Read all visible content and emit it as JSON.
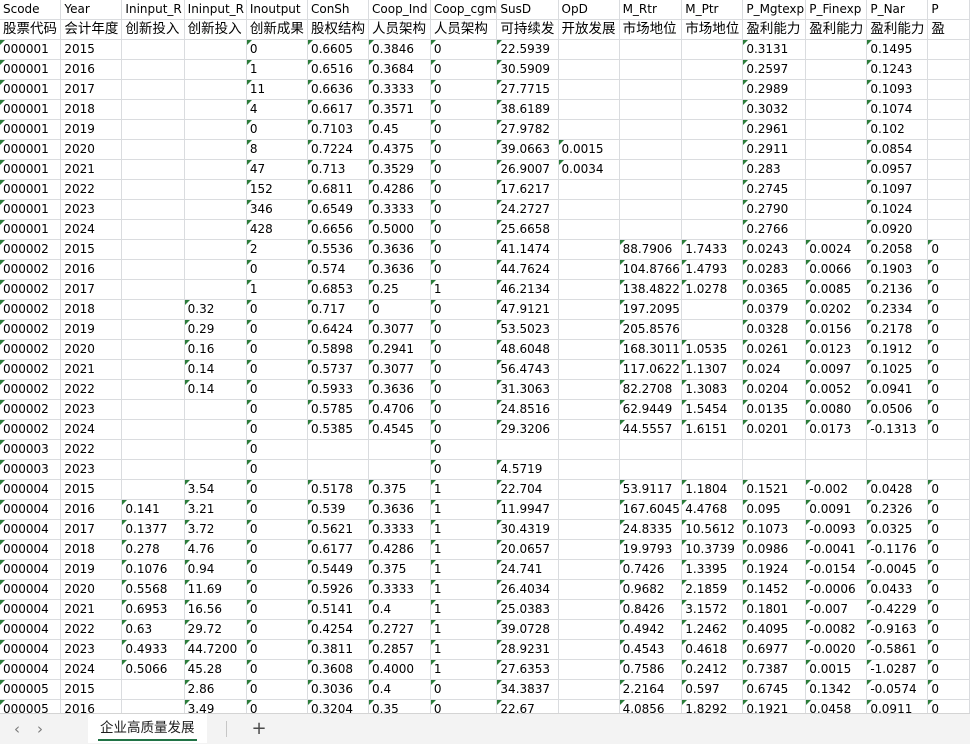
{
  "headers": [
    "Scode",
    "Year",
    "Ininput_R",
    "Ininput_R",
    "Inoutput",
    "ConSh",
    "Coop_Ind",
    "Coop_cgm",
    "SusD",
    "OpD",
    "M_Rtr",
    "M_Ptr",
    "P_Mgtexp",
    "P_Finexp",
    "P_Nar",
    "P"
  ],
  "labels": [
    "股票代码",
    "会计年度",
    "创新投入",
    "创新投入",
    "创新成果",
    "股权结构",
    "人员架构",
    "人员架构",
    "可持续发",
    "开放发展",
    "市场地位",
    "市场地位",
    "盈利能力",
    "盈利能力",
    "盈利能力",
    "盈"
  ],
  "rows": [
    [
      "000001",
      "2015",
      "",
      "",
      "0",
      "0.6605",
      "0.3846",
      "0",
      "22.5939",
      "",
      "",
      "",
      "0.3131",
      "",
      "0.1495",
      ""
    ],
    [
      "000001",
      "2016",
      "",
      "",
      "1",
      "0.6516",
      "0.3684",
      "0",
      "30.5909",
      "",
      "",
      "",
      "0.2597",
      "",
      "0.1243",
      ""
    ],
    [
      "000001",
      "2017",
      "",
      "",
      "11",
      "0.6636",
      "0.3333",
      "0",
      "27.7715",
      "",
      "",
      "",
      "0.2989",
      "",
      "0.1093",
      ""
    ],
    [
      "000001",
      "2018",
      "",
      "",
      "4",
      "0.6617",
      "0.3571",
      "0",
      "38.6189",
      "",
      "",
      "",
      "0.3032",
      "",
      "0.1074",
      ""
    ],
    [
      "000001",
      "2019",
      "",
      "",
      "0",
      "0.7103",
      "0.45",
      "0",
      "27.9782",
      "",
      "",
      "",
      "0.2961",
      "",
      "0.102",
      ""
    ],
    [
      "000001",
      "2020",
      "",
      "",
      "8",
      "0.7224",
      "0.4375",
      "0",
      "39.0663",
      "0.0015",
      "",
      "",
      "0.2911",
      "",
      "0.0854",
      ""
    ],
    [
      "000001",
      "2021",
      "",
      "",
      "47",
      "0.713",
      "0.3529",
      "0",
      "26.9007",
      "0.0034",
      "",
      "",
      "0.283",
      "",
      "0.0957",
      ""
    ],
    [
      "000001",
      "2022",
      "",
      "",
      "152",
      "0.6811",
      "0.4286",
      "0",
      "17.6217",
      "",
      "",
      "",
      "0.2745",
      "",
      "0.1097",
      ""
    ],
    [
      "000001",
      "2023",
      "",
      "",
      "346",
      "0.6549",
      "0.3333",
      "0",
      "24.2727",
      "",
      "",
      "",
      "0.2790",
      "",
      "0.1024",
      ""
    ],
    [
      "000001",
      "2024",
      "",
      "",
      "428",
      "0.6656",
      "0.5000",
      "0",
      "25.6658",
      "",
      "",
      "",
      "0.2766",
      "",
      "0.0920",
      ""
    ],
    [
      "000002",
      "2015",
      "",
      "",
      "2",
      "0.5536",
      "0.3636",
      "0",
      "41.1474",
      "",
      "88.7906",
      "1.7433",
      "0.0243",
      "0.0024",
      "0.2058",
      "0"
    ],
    [
      "000002",
      "2016",
      "",
      "",
      "0",
      "0.574",
      "0.3636",
      "0",
      "44.7624",
      "",
      "104.8766",
      "1.4793",
      "0.0283",
      "0.0066",
      "0.1903",
      "0"
    ],
    [
      "000002",
      "2017",
      "",
      "",
      "1",
      "0.6853",
      "0.25",
      "1",
      "46.2134",
      "",
      "138.4822",
      "1.0278",
      "0.0365",
      "0.0085",
      "0.2136",
      "0"
    ],
    [
      "000002",
      "2018",
      "",
      "0.32",
      "0",
      "0.717",
      "0",
      "0",
      "47.9121",
      "",
      "197.2095",
      "",
      "0.0379",
      "0.0202",
      "0.2334",
      "0"
    ],
    [
      "000002",
      "2019",
      "",
      "0.29",
      "0",
      "0.6424",
      "0.3077",
      "0",
      "53.5023",
      "",
      "205.8576",
      "",
      "0.0328",
      "0.0156",
      "0.2178",
      "0"
    ],
    [
      "000002",
      "2020",
      "",
      "0.16",
      "0",
      "0.5898",
      "0.2941",
      "0",
      "48.6048",
      "",
      "168.3011",
      "1.0535",
      "0.0261",
      "0.0123",
      "0.1912",
      "0"
    ],
    [
      "000002",
      "2021",
      "",
      "0.14",
      "0",
      "0.5737",
      "0.3077",
      "0",
      "56.4743",
      "",
      "117.0622",
      "1.1307",
      "0.024",
      "0.0097",
      "0.1025",
      "0"
    ],
    [
      "000002",
      "2022",
      "",
      "0.14",
      "0",
      "0.5933",
      "0.3636",
      "0",
      "31.3063",
      "",
      "82.2708",
      "1.3083",
      "0.0204",
      "0.0052",
      "0.0941",
      "0"
    ],
    [
      "000002",
      "2023",
      "",
      "",
      "0",
      "0.5785",
      "0.4706",
      "0",
      "24.8516",
      "",
      "62.9449",
      "1.5454",
      "0.0135",
      "0.0080",
      "0.0506",
      "0"
    ],
    [
      "000002",
      "2024",
      "",
      "",
      "0",
      "0.5385",
      "0.4545",
      "0",
      "29.3206",
      "",
      "44.5557",
      "1.6151",
      "0.0201",
      "0.0173",
      "-0.1313",
      "0"
    ],
    [
      "000003",
      "2022",
      "",
      "",
      "0",
      "",
      "",
      "0",
      "",
      "",
      "",
      "",
      "",
      "",
      "",
      ""
    ],
    [
      "000003",
      "2023",
      "",
      "",
      "0",
      "",
      "",
      "0",
      "4.5719",
      "",
      "",
      "",
      "",
      "",
      "",
      ""
    ],
    [
      "000004",
      "2015",
      "",
      "3.54",
      "0",
      "0.5178",
      "0.375",
      "1",
      "22.704",
      "",
      "53.9117",
      "1.1804",
      "0.1521",
      "-0.002",
      "0.0428",
      "0"
    ],
    [
      "000004",
      "2016",
      "0.141",
      "3.21",
      "0",
      "0.539",
      "0.3636",
      "1",
      "11.9947",
      "",
      "167.6045",
      "4.4768",
      "0.095",
      "0.0091",
      "0.2326",
      "0"
    ],
    [
      "000004",
      "2017",
      "0.1377",
      "3.72",
      "0",
      "0.5621",
      "0.3333",
      "1",
      "30.4319",
      "",
      "24.8335",
      "10.5612",
      "0.1073",
      "-0.0093",
      "0.0325",
      "0"
    ],
    [
      "000004",
      "2018",
      "0.278",
      "4.76",
      "0",
      "0.6177",
      "0.4286",
      "1",
      "20.0657",
      "",
      "19.9793",
      "10.3739",
      "0.0986",
      "-0.0041",
      "-0.1176",
      "0"
    ],
    [
      "000004",
      "2019",
      "0.1076",
      "0.94",
      "0",
      "0.5449",
      "0.375",
      "1",
      "24.741",
      "",
      "0.7426",
      "1.3395",
      "0.1924",
      "-0.0154",
      "-0.0045",
      "0"
    ],
    [
      "000004",
      "2020",
      "0.5568",
      "11.69",
      "0",
      "0.5926",
      "0.3333",
      "1",
      "26.4034",
      "",
      "0.9682",
      "2.1859",
      "0.1452",
      "-0.0006",
      "0.0433",
      "0"
    ],
    [
      "000004",
      "2021",
      "0.6953",
      "16.56",
      "0",
      "0.5141",
      "0.4",
      "1",
      "25.0383",
      "",
      "0.8426",
      "3.1572",
      "0.1801",
      "-0.007",
      "-0.4229",
      "0"
    ],
    [
      "000004",
      "2022",
      "0.63",
      "29.72",
      "0",
      "0.4254",
      "0.2727",
      "1",
      "39.0728",
      "",
      "0.4942",
      "1.2462",
      "0.4095",
      "-0.0082",
      "-0.9163",
      "0"
    ],
    [
      "000004",
      "2023",
      "0.4933",
      "44.7200",
      "0",
      "0.3811",
      "0.2857",
      "1",
      "28.9231",
      "",
      "0.4543",
      "0.4618",
      "0.6977",
      "-0.0020",
      "-0.5861",
      "0"
    ],
    [
      "000004",
      "2024",
      "0.5066",
      "45.28",
      "0",
      "0.3608",
      "0.4000",
      "1",
      "27.6353",
      "",
      "0.7586",
      "0.2412",
      "0.7387",
      "0.0015",
      "-1.0287",
      "0"
    ],
    [
      "000005",
      "2015",
      "",
      "2.86",
      "0",
      "0.3036",
      "0.4",
      "0",
      "34.3837",
      "",
      "2.2164",
      "0.597",
      "0.6745",
      "0.1342",
      "-0.0574",
      "0"
    ],
    [
      "000005",
      "2016",
      "",
      "3.49",
      "0",
      "0.3204",
      "0.35",
      "0",
      "22.67",
      "",
      "4.0856",
      "1.8292",
      "0.1921",
      "0.0458",
      "0.0911",
      "0"
    ]
  ],
  "tabbar": {
    "prev_icon": "chevron-left-icon",
    "next_icon": "chevron-right-icon",
    "sheet_name": "企业高质量发展",
    "add_icon": "plus-icon",
    "accent": "#217346"
  },
  "colors": {
    "indicator": "#2b7d3a",
    "gridline": "#dadcdf"
  }
}
